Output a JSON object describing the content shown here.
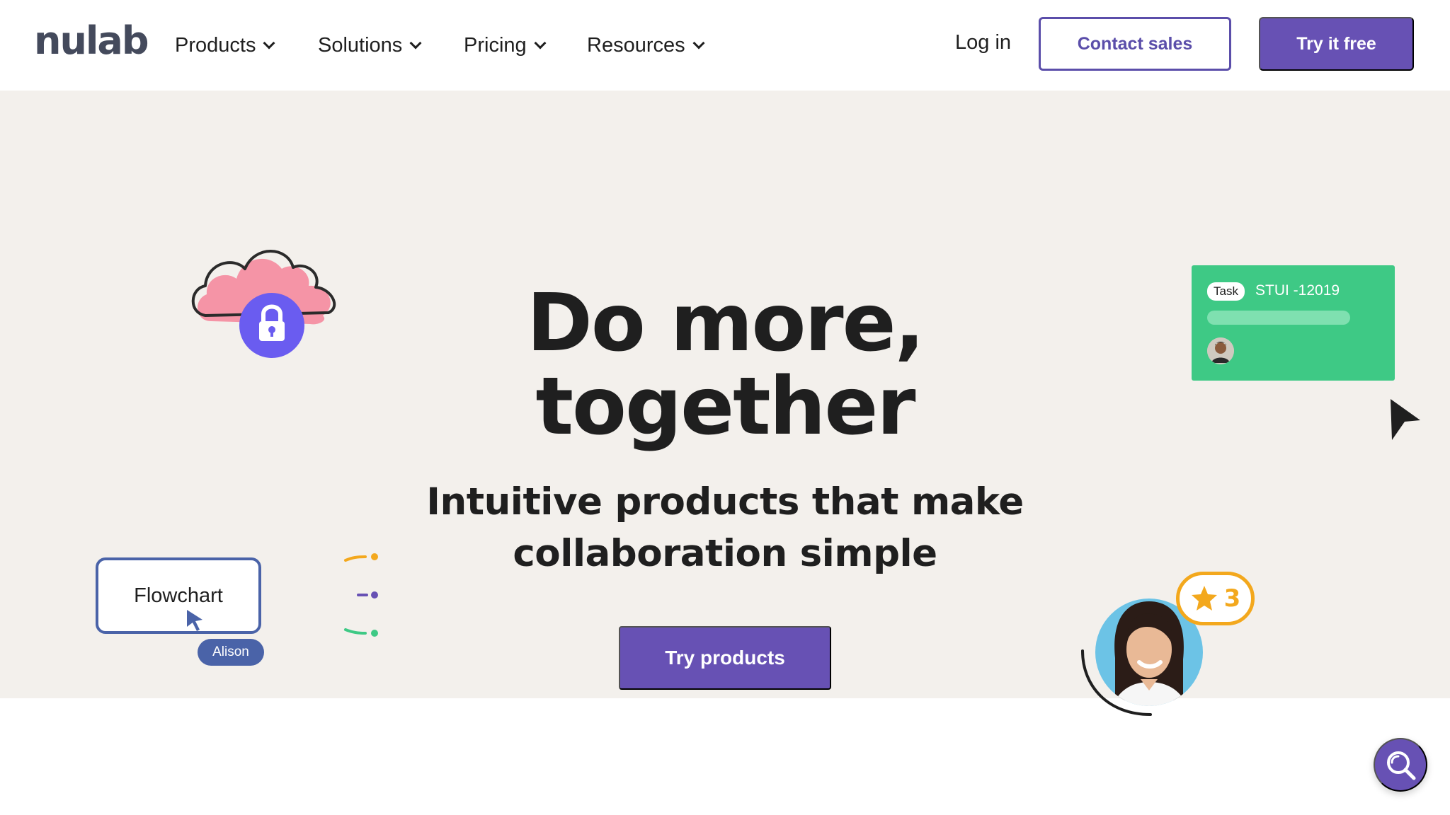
{
  "nav": {
    "logo": "nulab",
    "menu": [
      {
        "label": "Products"
      },
      {
        "label": "Solutions"
      },
      {
        "label": "Pricing"
      },
      {
        "label": "Resources"
      }
    ],
    "login": "Log in",
    "contact_sales": "Contact sales",
    "try_free": "Try it free"
  },
  "hero": {
    "headline_line1": "Do more,",
    "headline_line2": "together",
    "subhead_line1": "Intuitive products that make",
    "subhead_line2": "collaboration simple",
    "cta": "Try products",
    "task_card": {
      "badge": "Task",
      "id": "STUI -12019"
    },
    "flowchart": {
      "label": "Flowchart",
      "user": "Alison"
    },
    "star_badge": {
      "count": "3"
    }
  },
  "colors": {
    "brand_purple": "#6751b4",
    "hero_bg": "#f3f0ec",
    "task_green": "#3ec985",
    "flow_blue": "#4a63a8",
    "star_orange": "#f3a81d",
    "cloud_pink": "#f594a6",
    "lock_purple": "#6a5cf0"
  },
  "icons": {
    "menu_chevron": "chevron-down-icon",
    "cloud": "cloud-icon",
    "lock": "lock-icon",
    "cursor": "cursor-arrow-icon",
    "star": "star-icon",
    "search": "search-icon"
  }
}
